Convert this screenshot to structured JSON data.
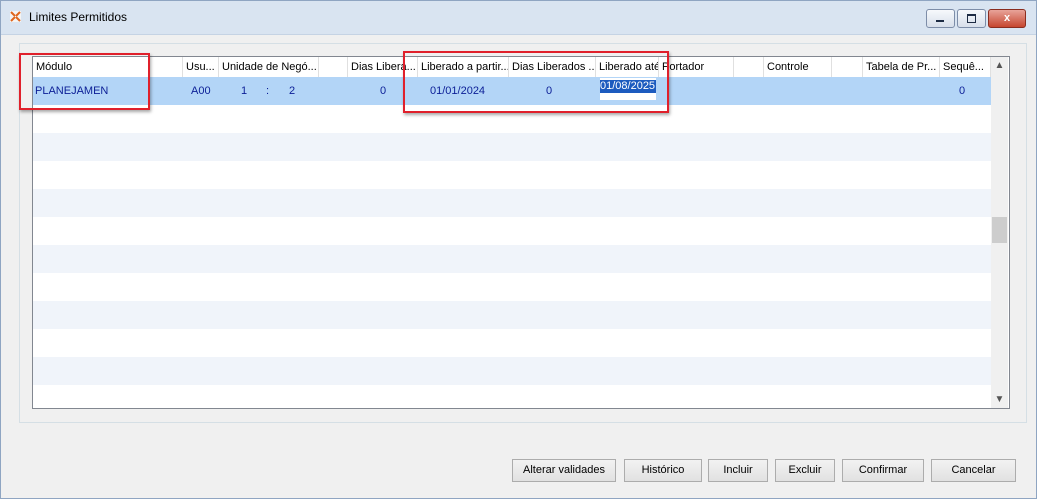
{
  "window": {
    "title": "Limites Permitidos",
    "accent": "#d9e4f1",
    "icons": {
      "app": "app-logo-icon",
      "minimize": "minimize-icon",
      "maximize": "maximize-icon",
      "close": "close-icon"
    },
    "close_glyph": "x"
  },
  "grid": {
    "columns": [
      "Módulo",
      "Usu...",
      "Unidade de Negó...",
      "",
      "Dias Libera...",
      "Liberado a partir...",
      "Dias Liberados ...",
      "Liberado até",
      "Portador",
      "",
      "Controle",
      "",
      "Tabela de Pr...",
      "Sequê..."
    ],
    "rows": [
      {
        "modulo": "PLANEJAMEN",
        "usuario": "A00",
        "unidade_a": "1",
        "unidade_sep": ":",
        "unidade_b": "2",
        "dias_liberados": "0",
        "liberado_a_partir": "01/01/2024",
        "dias_liberados_2": "0",
        "liberado_ate": "01/08/2025",
        "sequencia": "0"
      }
    ],
    "selected_row_color": "#b3d5f7",
    "alt_row_color": "#f0f4fa"
  },
  "scrollbar": {
    "up": "▲",
    "down": "▼"
  },
  "buttons": {
    "alterar_validades": "Alterar validades",
    "historico": "Histórico",
    "incluir": "Incluir",
    "excluir": "Excluir",
    "confirmar": "Confirmar",
    "cancelar": "Cancelar"
  },
  "annotation_color": "#e0202b"
}
